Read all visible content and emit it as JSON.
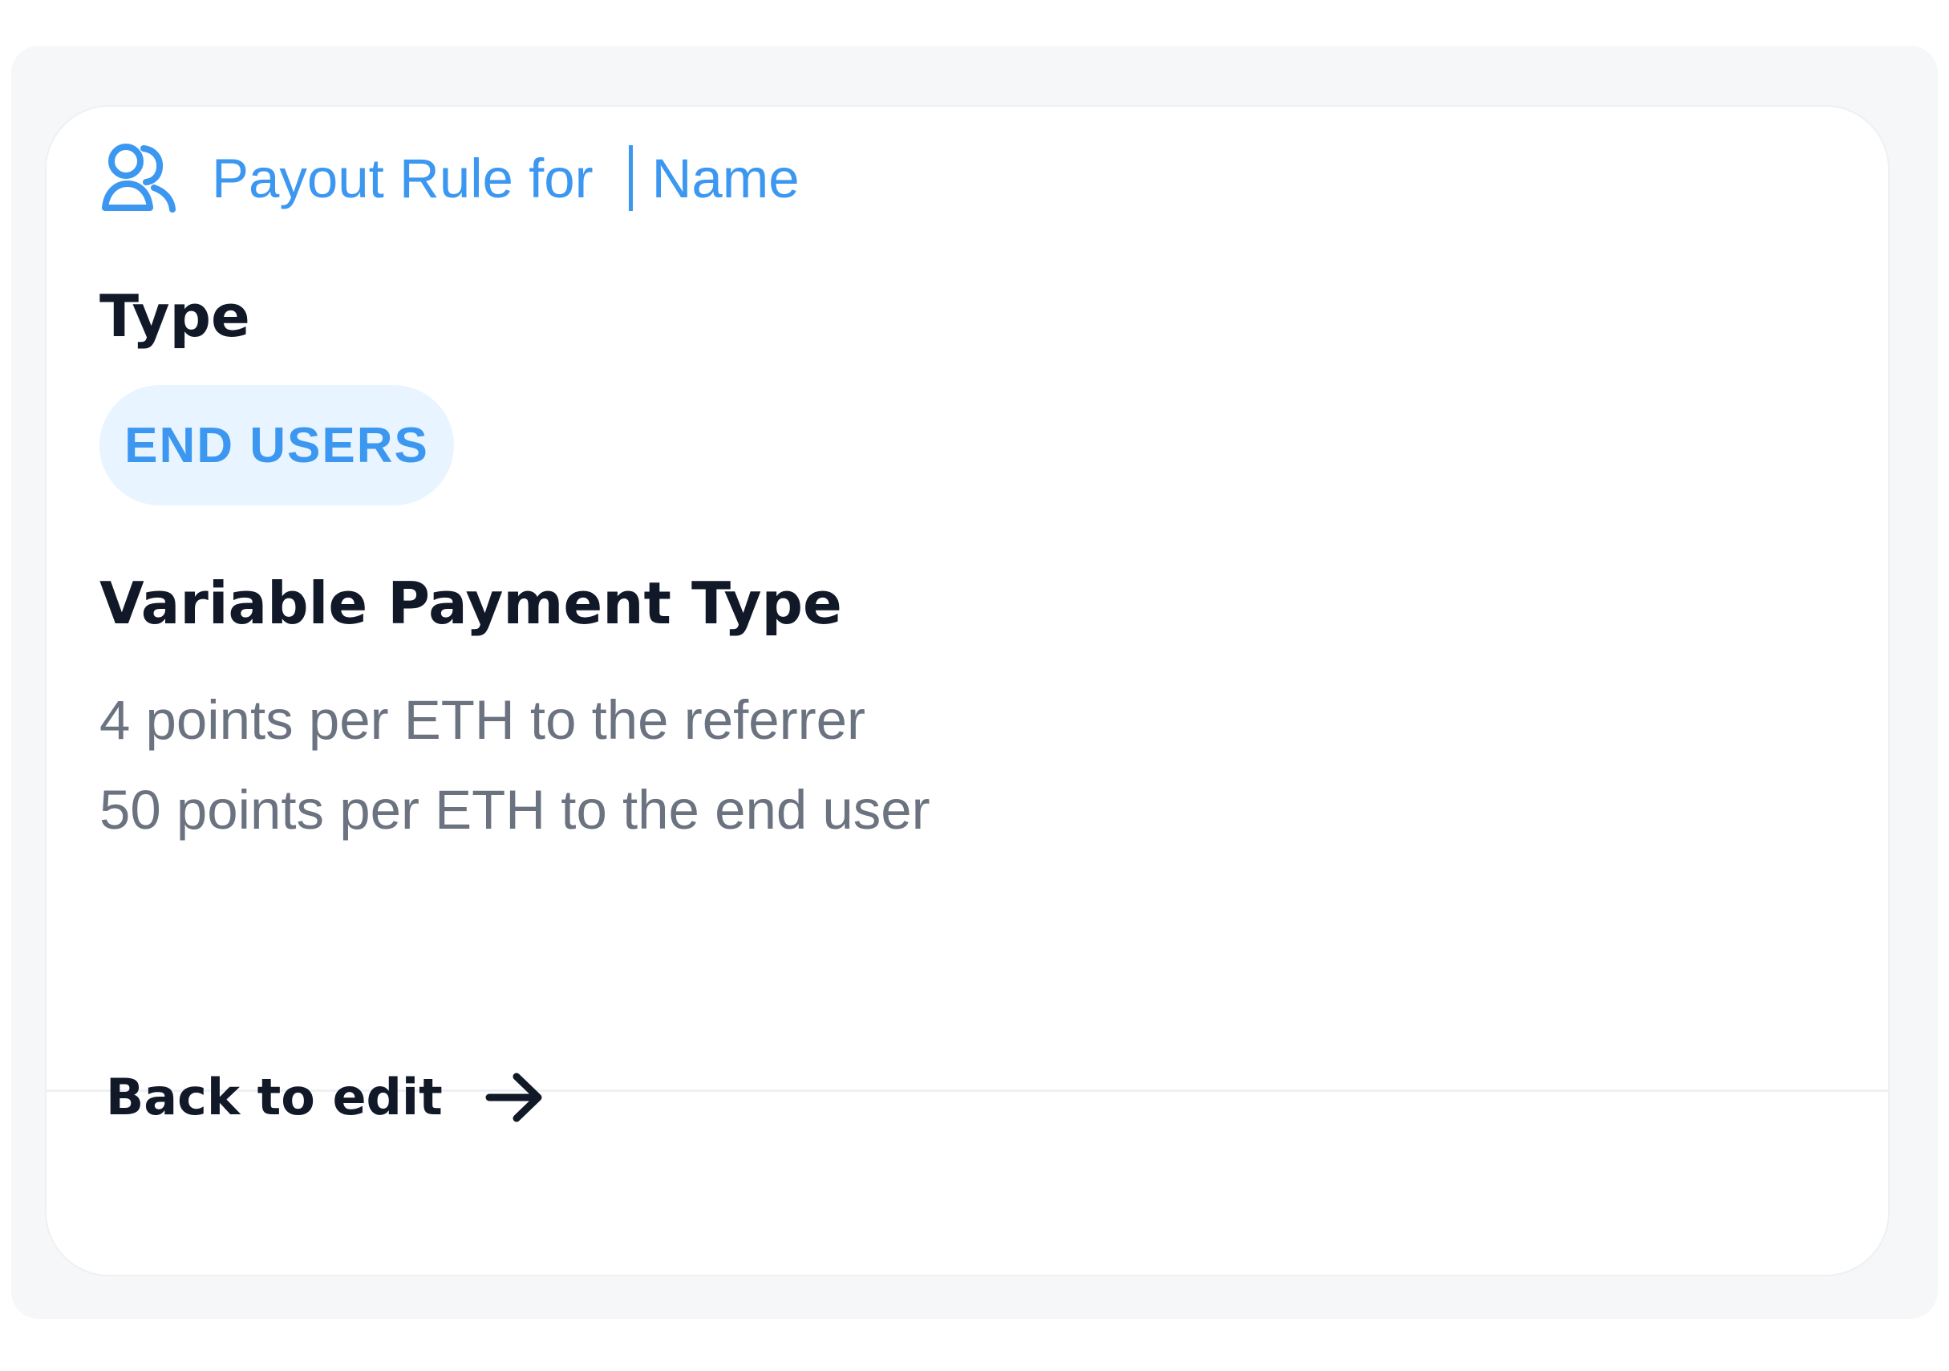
{
  "header": {
    "icon": "users-icon",
    "title": "Payout Rule for",
    "name": "Name"
  },
  "type": {
    "label": "Type",
    "badge": "END USERS"
  },
  "payment": {
    "label": "Variable Payment Type",
    "lines": [
      "4 points per ETH to the referrer",
      "50 points per ETH to the end user"
    ]
  },
  "footer": {
    "back_label": "Back to edit",
    "icon": "arrow-right-icon"
  },
  "colors": {
    "accent": "#3c97f0",
    "badge_background": "#e8f4ff",
    "heading": "#111827",
    "muted_text": "#6b7280"
  }
}
